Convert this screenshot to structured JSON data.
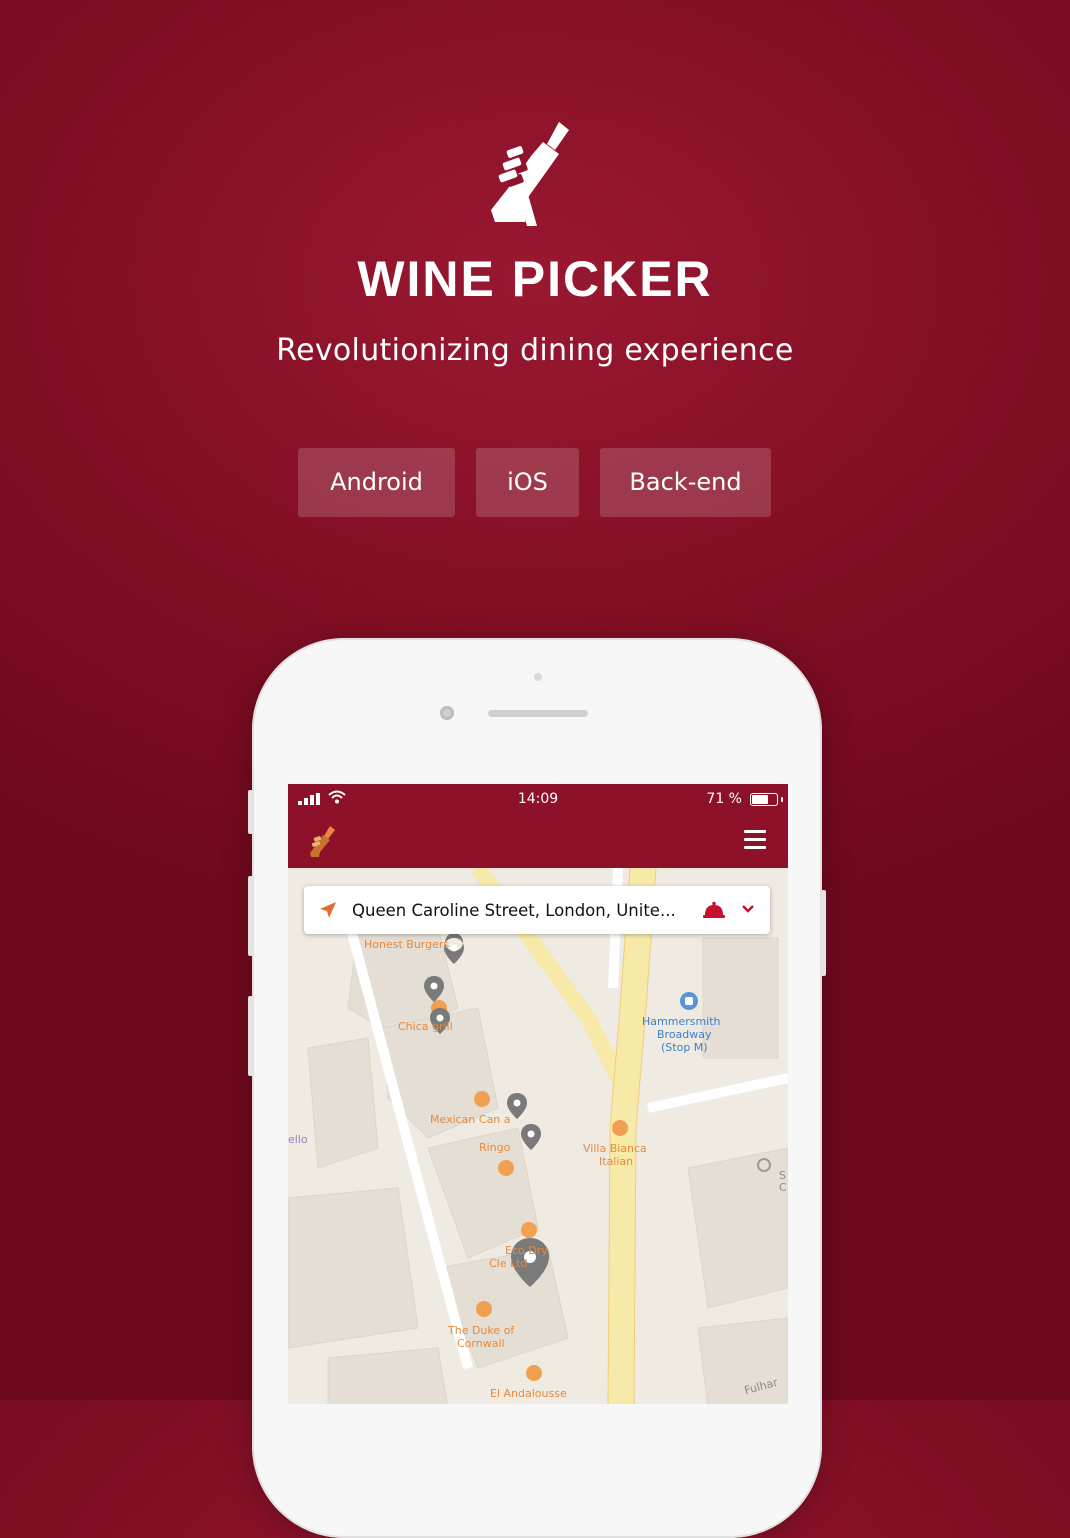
{
  "brand": {
    "name": "WINE PICKER",
    "tagline": "Revolutionizing dining experience"
  },
  "platform_buttons": [
    "Android",
    "iOS",
    "Back-end"
  ],
  "phone": {
    "status_bar": {
      "time": "14:09",
      "battery_text": "71 %",
      "battery_level": 0.71
    },
    "search": {
      "address": "Queen Caroline Street, London, Unite..."
    },
    "map_labels": {
      "honest_burgers": "Honest Burgers",
      "chicago_grill": "Chica   grill",
      "hammersmith_1": "Hammersmith",
      "hammersmith_2": "Broadway",
      "hammersmith_3": "(Stop M)",
      "mexican": "Mexican Can   a",
      "ringo": "Ringo",
      "villa_1": "Villa Bianca",
      "villa_2": "Italian",
      "eco_1": "Eco Dry",
      "eco_2": "Cle          Ltd",
      "duke_1": "The Duke of",
      "duke_2": "Cornwall",
      "el_andalousse": "El Andalousse",
      "fulham": "Fulhar",
      "edge_left": "ello",
      "edge_right_1": "S",
      "edge_right_2": "C"
    }
  },
  "colors": {
    "brand_red": "#8c1129",
    "accent_orange": "#e8893b",
    "pin_grey": "#7a7a7a"
  },
  "icons": [
    "wine-bottle-hand-logo-icon",
    "signal-icon",
    "wifi-icon",
    "battery-icon",
    "menu-icon",
    "navigation-arrow-icon",
    "cloche-icon",
    "chevron-down-icon",
    "map-pin-icon"
  ]
}
